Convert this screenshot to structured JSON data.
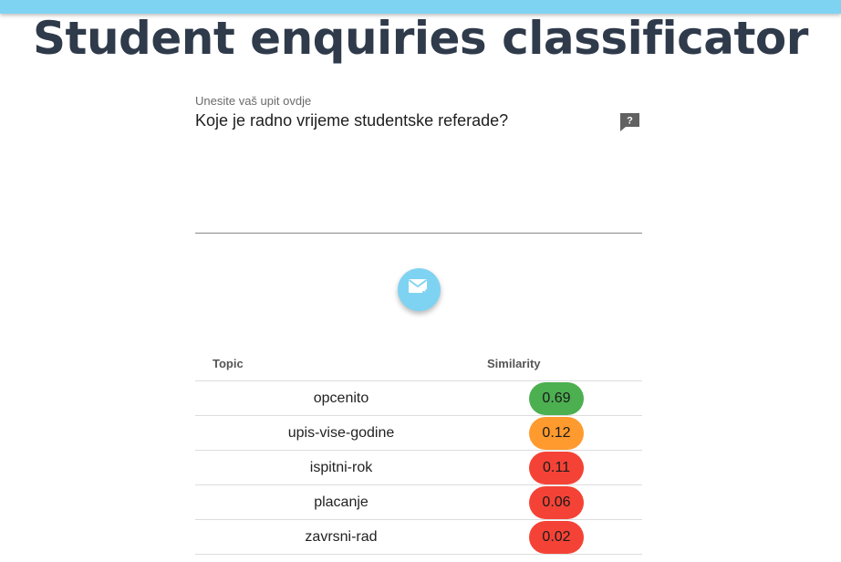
{
  "header": {
    "title": "Student enquiries classificator"
  },
  "query": {
    "label": "Unesite vaš upit ovdje",
    "value": "Koje je radno vrijeme studentske referade?",
    "help_icon": "question-chat-icon"
  },
  "send": {
    "icon": "send-mail-icon"
  },
  "results": {
    "columns": [
      "Topic",
      "Similarity"
    ],
    "rows": [
      {
        "topic": "opcenito",
        "similarity": "0.69",
        "color": "#4caf50"
      },
      {
        "topic": "upis-vise-godine",
        "similarity": "0.12",
        "color": "#ff9a2e"
      },
      {
        "topic": "ispitni-rok",
        "similarity": "0.11",
        "color": "#f44336"
      },
      {
        "topic": "placanje",
        "similarity": "0.06",
        "color": "#f44336"
      },
      {
        "topic": "zavrsni-rad",
        "similarity": "0.02",
        "color": "#f44336"
      }
    ]
  },
  "colors": {
    "accent": "#7fd3f2",
    "title": "#2f3a4b"
  }
}
